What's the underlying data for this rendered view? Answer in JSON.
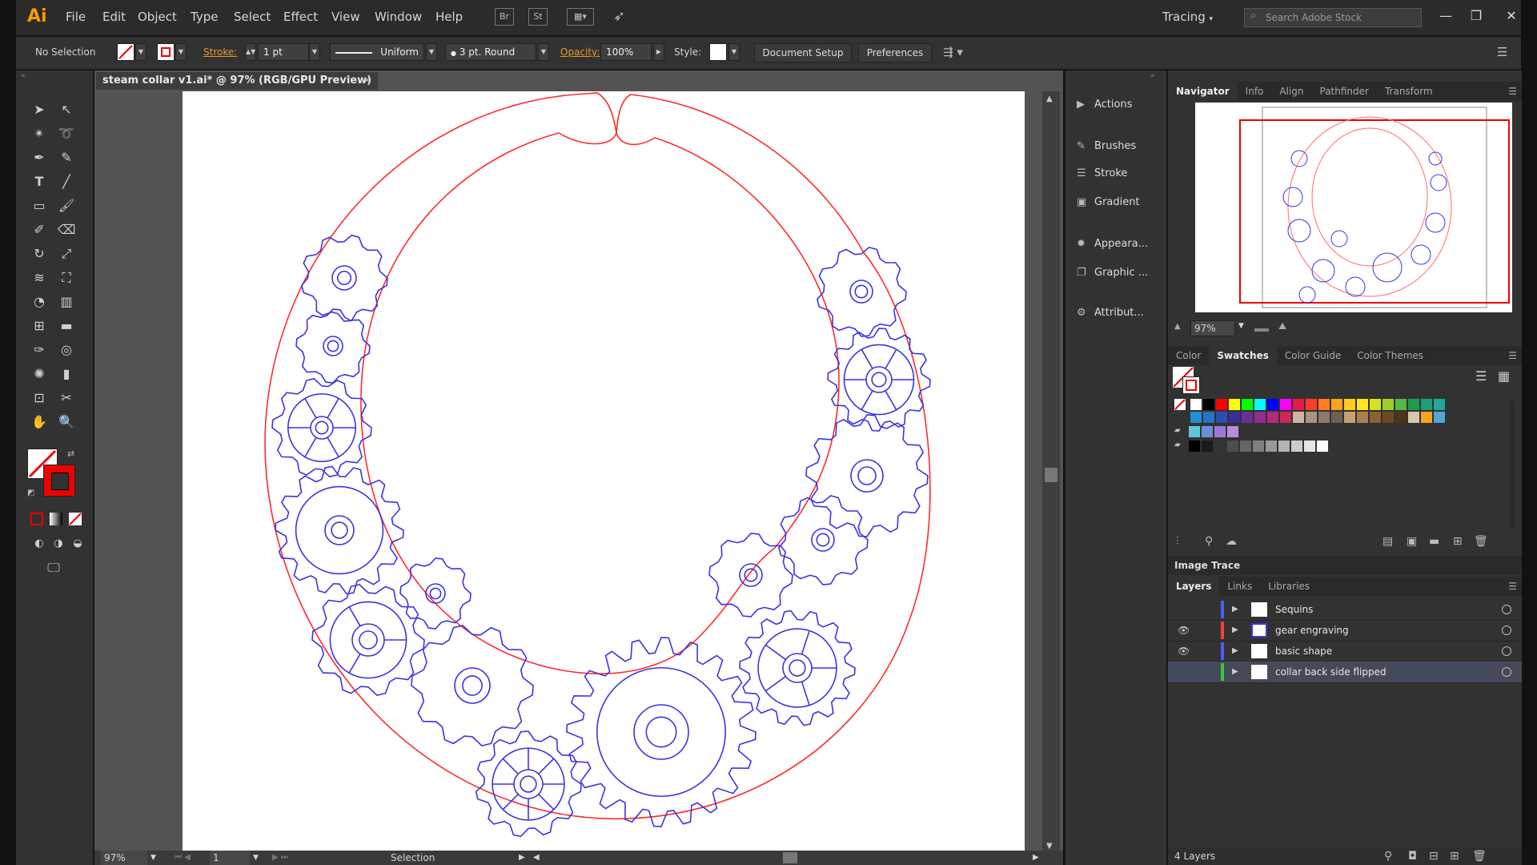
{
  "app": {
    "logo": "Ai"
  },
  "menu": [
    "File",
    "Edit",
    "Object",
    "Type",
    "Select",
    "Effect",
    "View",
    "Window",
    "Help"
  ],
  "menubar_icons": {
    "br": "Br",
    "st": "St"
  },
  "workspace": "Tracing",
  "search_placeholder": "Search Adobe Stock",
  "window_controls": {
    "min": "—",
    "max": "❐",
    "close": "✕"
  },
  "control_bar": {
    "selection": "No Selection",
    "stroke_label": "Stroke:",
    "stroke_value": "1 pt",
    "profile": "Uniform",
    "brush": "3 pt. Round",
    "opacity_label": "Opacity:",
    "opacity_value": "100%",
    "style_label": "Style:",
    "document_setup": "Document Setup",
    "preferences": "Preferences"
  },
  "document": {
    "tab_title": "steam collar v1.ai* @ 97% (RGB/GPU Preview)",
    "close": "×"
  },
  "status": {
    "zoom": "97%",
    "page": "1",
    "tool": "Selection"
  },
  "dock": [
    "Actions",
    "Brushes",
    "Stroke",
    "Gradient",
    "Appeara...",
    "Graphic ...",
    "Attribut..."
  ],
  "navigator": {
    "tabs": [
      "Navigator",
      "Info",
      "Align",
      "Pathfinder",
      "Transform"
    ],
    "zoom": "97%"
  },
  "swatches_panel": {
    "tabs": [
      "Color",
      "Swatches",
      "Color Guide",
      "Color Themes"
    ],
    "row1": [
      "#ffffff",
      "#000000",
      "#ff0000",
      "#ffff00",
      "#00ff00",
      "#00ffff",
      "#0000ff",
      "#ff00ff",
      "#e6194b",
      "#ff3c28",
      "#ff7b25",
      "#ffa21f",
      "#ffcc1f",
      "#ffe41f",
      "#d6e21f",
      "#9ccf2a",
      "#52b847",
      "#1f9e4a",
      "#1f9e7a",
      "#1fa7a0"
    ],
    "row2": [
      "#1f8fd6",
      "#2672c9",
      "#2a4fb0",
      "#3a2f97",
      "#6a2f97",
      "#8f2f8f",
      "#b02a79",
      "#d0245a",
      "#c9b6a0",
      "#a89480",
      "#8a7a6a",
      "#6d5f52",
      "#c9a070",
      "#a8804f",
      "#8a6236",
      "#6d4a24",
      "#4f3418",
      "#d6c8a8",
      "#ffa21f",
      "#52a6d6"
    ],
    "row3": [
      "#63c6d6",
      "#6e8fd6",
      "#9a7ad6",
      "#b68fd6"
    ],
    "row4": [
      "#000000",
      "#1a1a1a",
      "#333333",
      "#4d4d4d",
      "#666666",
      "#808080",
      "#999999",
      "#b3b3b3",
      "#cccccc",
      "#e6e6e6",
      "#ffffff"
    ]
  },
  "image_trace": {
    "title": "Image Trace"
  },
  "layers_panel": {
    "tabs": [
      "Layers",
      "Links",
      "Libraries"
    ],
    "layers": [
      {
        "name": "Sequins",
        "color": "#4f5bff"
      },
      {
        "name": "gear engraving",
        "color": "#ff3c3c"
      },
      {
        "name": "basic shape",
        "color": "#4f5bff"
      },
      {
        "name": "collar back side flipped",
        "color": "#3cc83c"
      }
    ],
    "count": "4 Layers"
  },
  "colors": {
    "accent": "#ff9a00",
    "art_red": "#ff2b2b",
    "art_blue": "#3b35e0"
  }
}
